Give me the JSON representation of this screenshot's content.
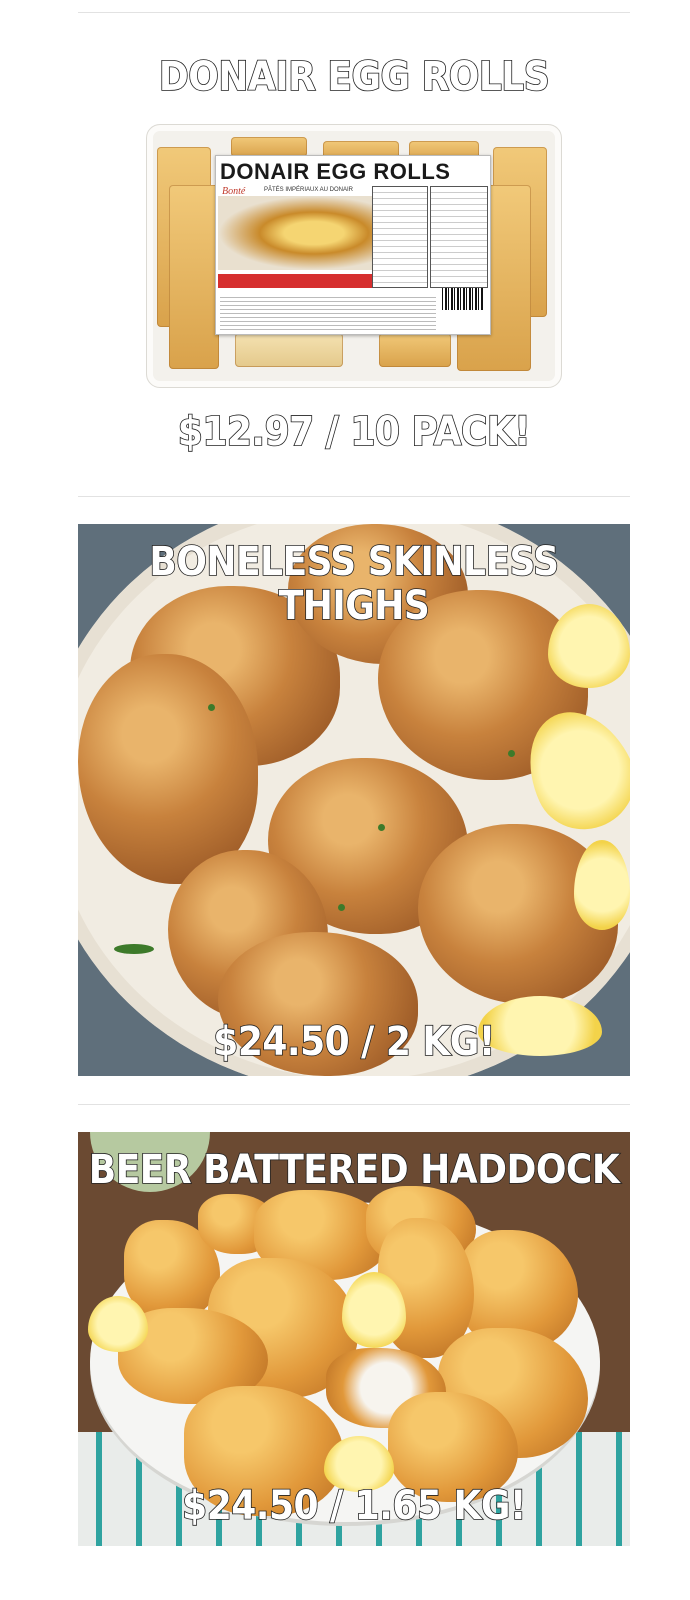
{
  "products": [
    {
      "title": "DONAIR EGG ROLLS",
      "price": "$12.97 / 10 PACK!",
      "package": {
        "label_title": "DONAIR EGG ROLLS",
        "brand": "Bonté",
        "subtitle": "PÂTÉS IMPÉRIAUX AU DONAIR"
      }
    },
    {
      "title": "BONELESS SKINLESS THIGHS",
      "price": "$24.50 / 2 KG!"
    },
    {
      "title": "BEER BATTERED HADDOCK",
      "price": "$24.50 / 1.65 KG!"
    }
  ]
}
